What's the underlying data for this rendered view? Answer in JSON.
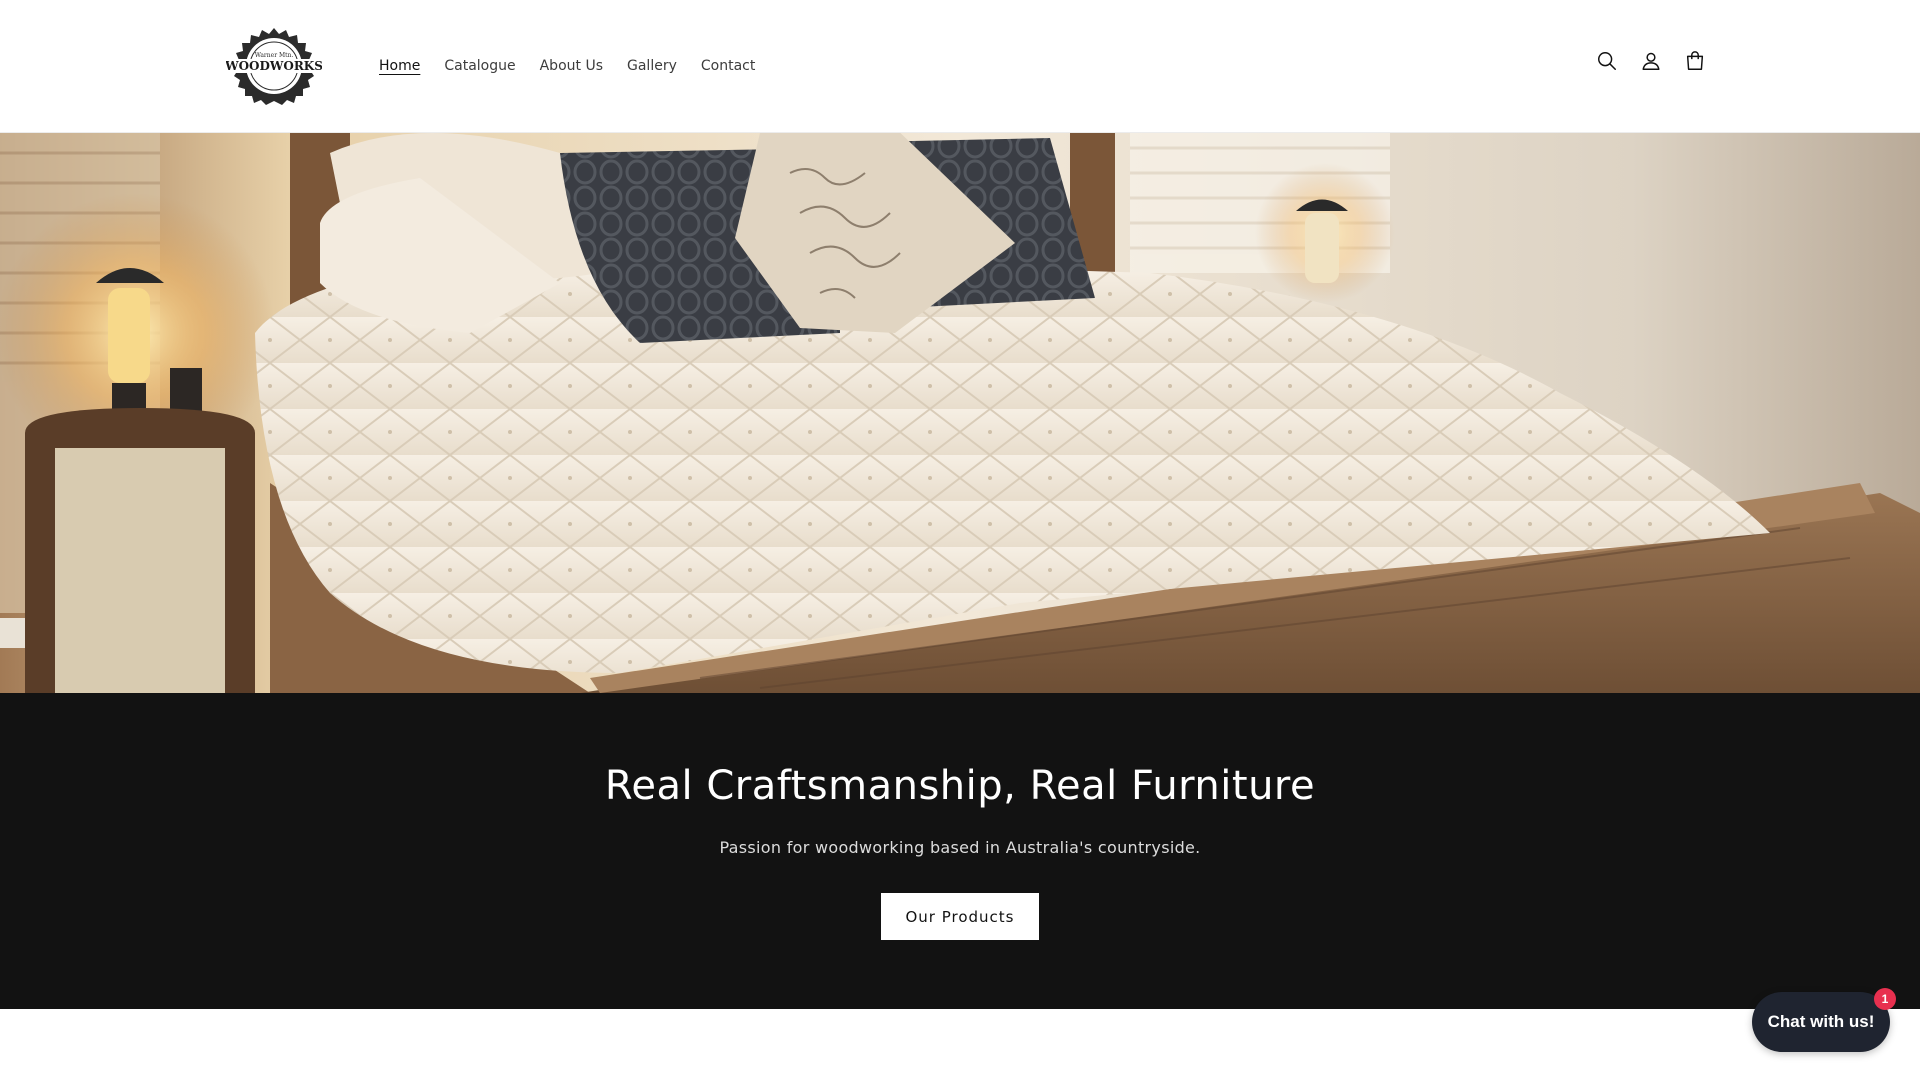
{
  "header": {
    "logo": {
      "top_text": "Warner Mtn.",
      "main_text": "WOODWORKS",
      "icon": "saw-blade-logo"
    },
    "nav": [
      {
        "label": "Home",
        "active": true
      },
      {
        "label": "Catalogue",
        "active": false
      },
      {
        "label": "About Us",
        "active": false
      },
      {
        "label": "Gallery",
        "active": false
      },
      {
        "label": "Contact",
        "active": false
      }
    ],
    "icons": [
      "search-icon",
      "account-icon",
      "cart-icon"
    ]
  },
  "hero": {
    "image": "bedroom-wooden-bed-photo"
  },
  "banner": {
    "title": "Real Craftsmanship, Real Furniture",
    "subtitle": "Passion for woodworking based in Australia's countryside.",
    "button_label": "Our Products"
  },
  "chat": {
    "label": "Chat with us!",
    "badge_count": "1"
  },
  "colors": {
    "banner_bg": "#121212",
    "chat_bg": "#1f2430",
    "badge": "#e8304f"
  }
}
